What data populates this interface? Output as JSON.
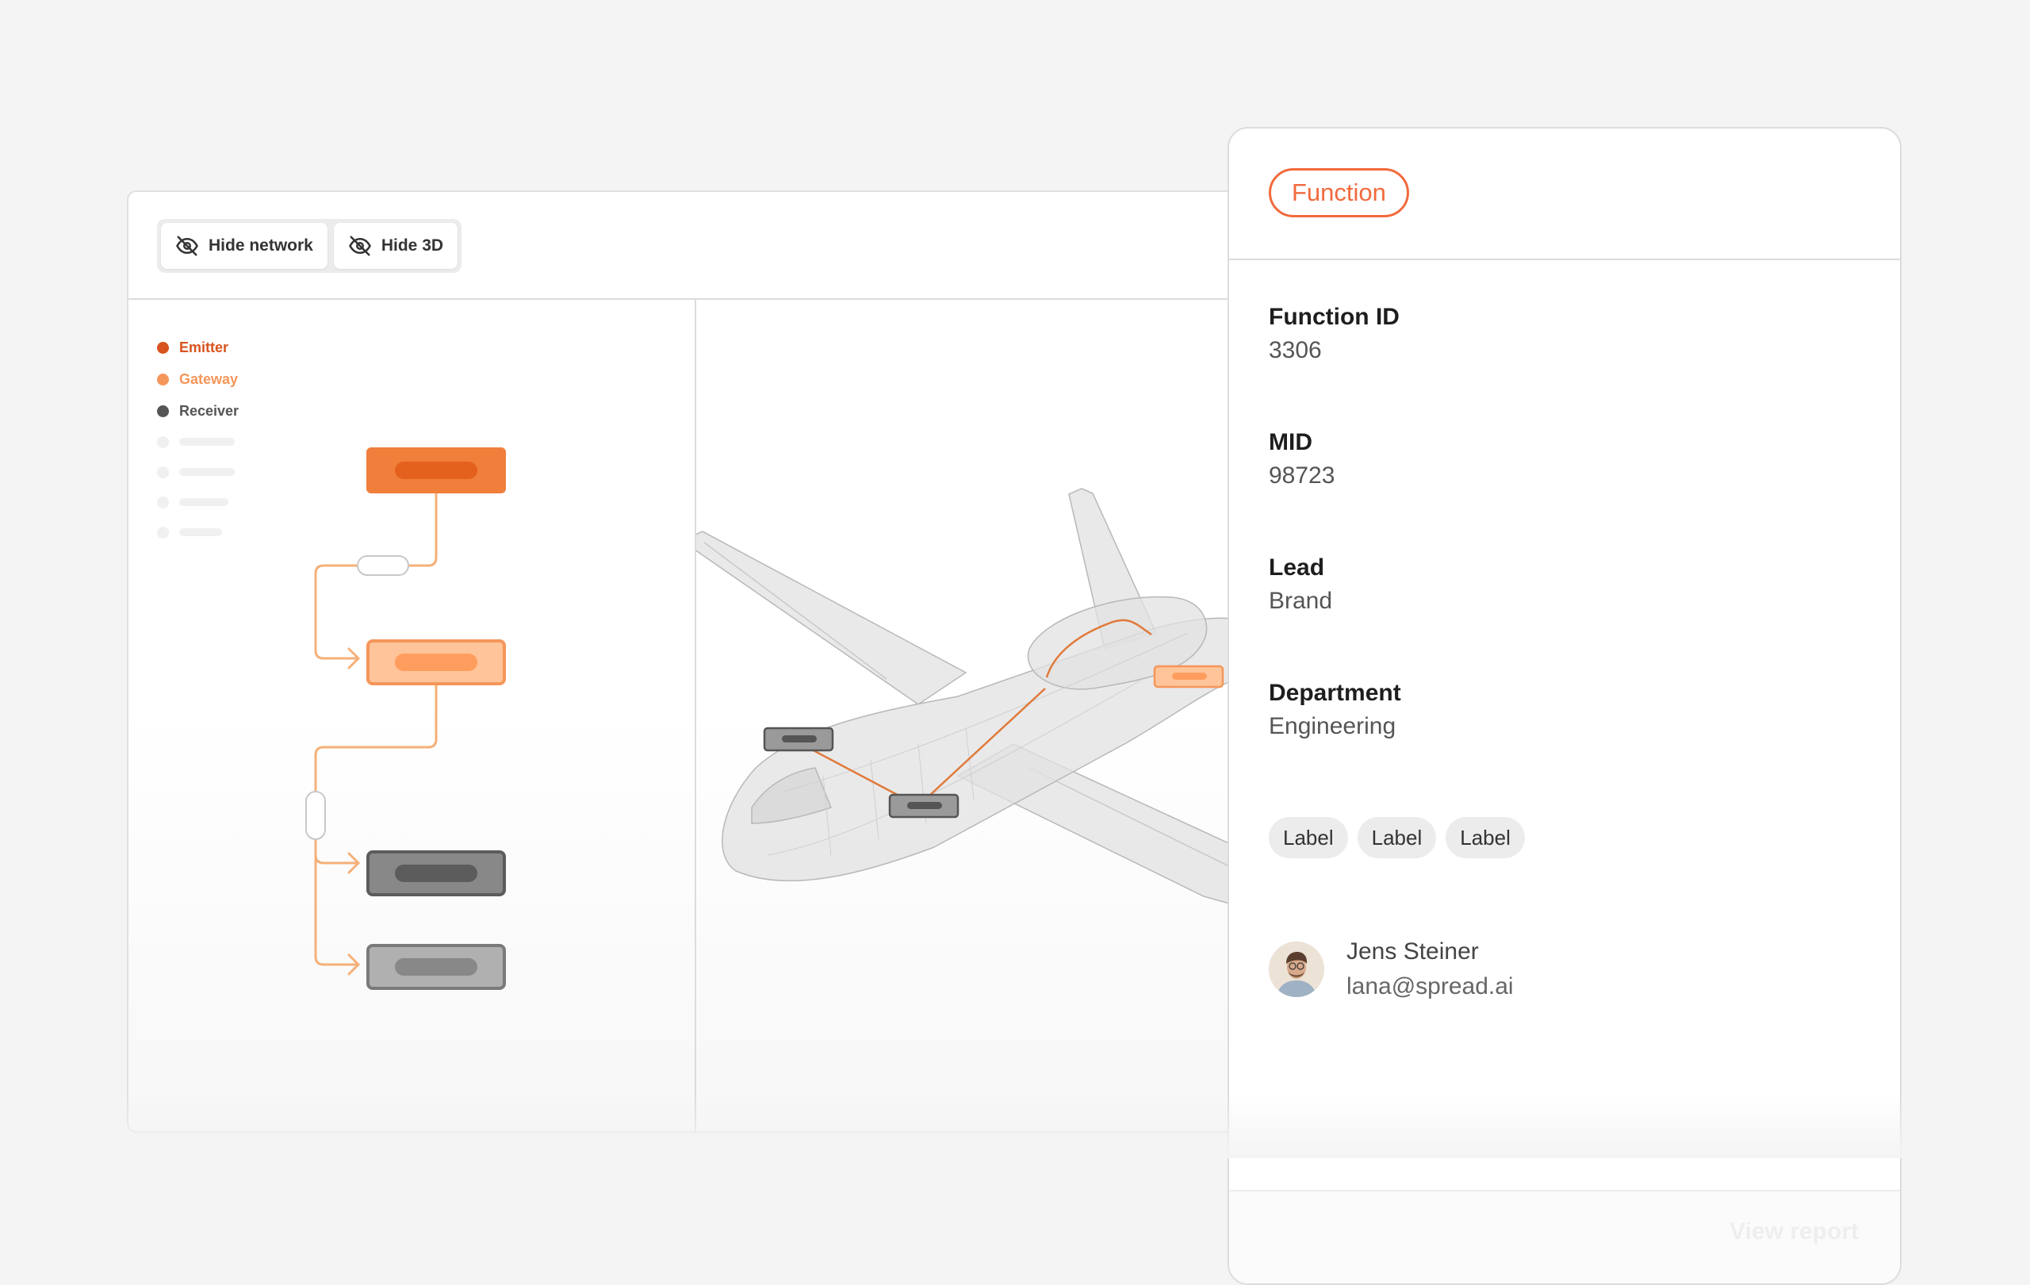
{
  "toolbar": {
    "hide_network_label": "Hide network",
    "hide_3d_label": "Hide 3D"
  },
  "legend": {
    "items": [
      {
        "label": "Emitter",
        "color": "#d9531e"
      },
      {
        "label": "Gateway",
        "color": "#f5965a"
      },
      {
        "label": "Receiver",
        "color": "#555555"
      }
    ]
  },
  "panel": {
    "type_label": "Function",
    "fields": [
      {
        "label": "Function ID",
        "value": "3306"
      },
      {
        "label": "MID",
        "value": "98723"
      },
      {
        "label": "Lead",
        "value": "Brand"
      },
      {
        "label": "Department",
        "value": "Engineering"
      }
    ],
    "labels": [
      "Label",
      "Label",
      "Label"
    ],
    "user": {
      "name": "Jens Steiner",
      "email": "lana@spread.ai"
    },
    "footer_action": "View report"
  },
  "colors": {
    "accent": "#f26a3d",
    "emitter": "#f07f3c",
    "gateway": "#ffc49a",
    "receiver": "#777777",
    "connector": "#f5b078"
  },
  "icons": {
    "toggle": "eye-slash-icon",
    "plane": "aircraft-xray-model"
  }
}
